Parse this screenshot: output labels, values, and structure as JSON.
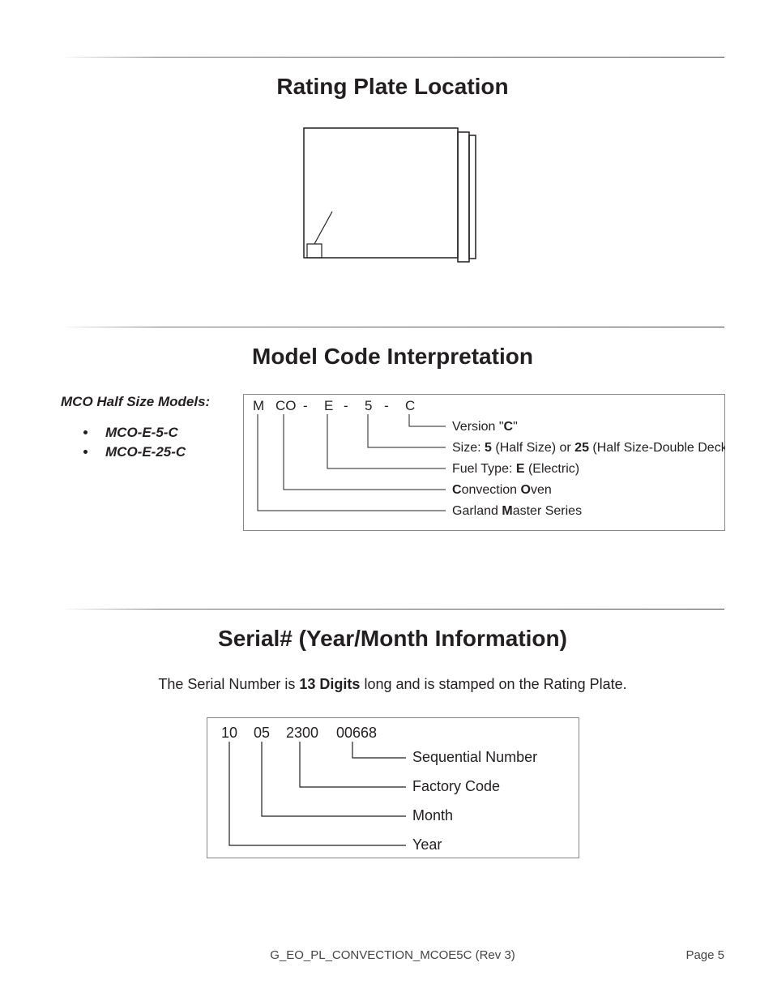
{
  "headings": {
    "rating": "Rating Plate Location",
    "model": "Model Code Interpretation",
    "serial": "Serial# (Year/Month Information)"
  },
  "models": {
    "head": "MCO Half Size Models:",
    "items": [
      "MCO-E-5-C",
      "MCO-E-25-C"
    ]
  },
  "model_code": {
    "parts": [
      "M",
      "CO",
      "-",
      "E",
      "-",
      "5",
      "-",
      "C"
    ],
    "explain": {
      "version_pre": "Version \"",
      "version_bold": "C",
      "version_post": "\"",
      "size_pre": "Size: ",
      "size_b1": "5",
      "size_mid": " (Half Size) or ",
      "size_b2": "25",
      "size_post": " (Half Size-Double Deck)",
      "fuel_pre": "Fuel Type: ",
      "fuel_b": "E",
      "fuel_post": " (Electric)",
      "conv_b1": "C",
      "conv_mid": "onvection ",
      "conv_b2": "O",
      "conv_post": "ven",
      "master_pre": "Garland ",
      "master_b": "M",
      "master_post": "aster Series"
    }
  },
  "serial": {
    "intro_pre": "The Serial Number is ",
    "intro_bold": "13 Digits",
    "intro_post": " long and is stamped on the Rating Plate.",
    "groups": [
      "10",
      "05",
      "2300",
      "00668"
    ],
    "labels": [
      "Sequential Number",
      "Factory Code",
      "Month",
      "Year"
    ]
  },
  "footer": {
    "center": "G_EO_PL_CONVECTION_MCOE5C (Rev 3)",
    "right": "Page 5"
  }
}
